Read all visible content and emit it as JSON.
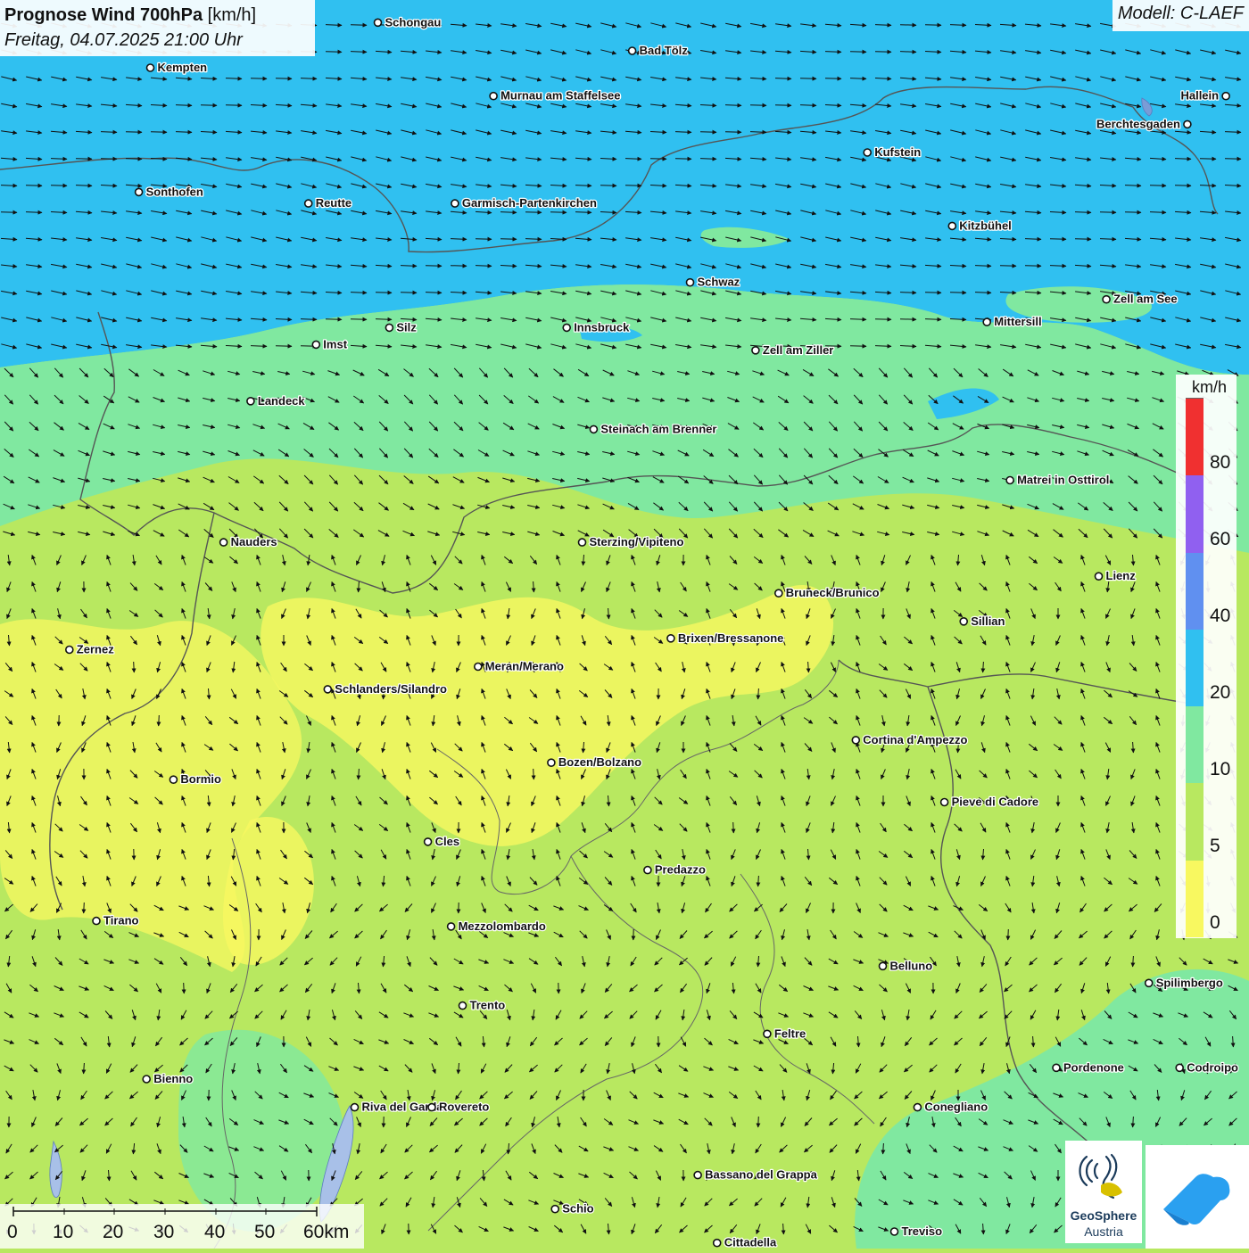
{
  "header": {
    "title_bold": "Prognose Wind 700hPa",
    "title_unit": "[km/h]",
    "datetime": "Freitag, 04.07.2025 21:00 Uhr"
  },
  "model": {
    "label": "Modell: C-LAEF"
  },
  "legend": {
    "unit": "km/h",
    "classes": [
      {
        "from": 0,
        "to": 5,
        "color": "#f8f860"
      },
      {
        "from": 5,
        "to": 10,
        "color": "#b8e860"
      },
      {
        "from": 10,
        "to": 20,
        "color": "#80e8a0"
      },
      {
        "from": 20,
        "to": 40,
        "color": "#30c0f0"
      },
      {
        "from": 40,
        "to": 60,
        "color": "#6090f0"
      },
      {
        "from": 60,
        "to": 80,
        "color": "#9060f0"
      },
      {
        "from": 80,
        "to": 100,
        "color": "#f03030"
      }
    ],
    "labels": [
      "0",
      "5",
      "10",
      "20",
      "40",
      "60",
      "80"
    ]
  },
  "scale": {
    "labels": [
      "0",
      "10",
      "20",
      "30",
      "40",
      "50",
      "60km"
    ]
  },
  "logo": {
    "name_line1": "GeoSphere",
    "name_line2": "Austria"
  },
  "cities": [
    {
      "name": "Schongau",
      "lon": 10.9,
      "lat": 47.81
    },
    {
      "name": "Bad Tölz",
      "lon": 11.56,
      "lat": 47.76
    },
    {
      "name": "Kempten",
      "lon": 10.31,
      "lat": 47.73
    },
    {
      "name": "Murnau am Staffelsee",
      "lon": 11.2,
      "lat": 47.68
    },
    {
      "name": "Hallein",
      "lon": 13.1,
      "lat": 47.68
    },
    {
      "name": "Berchtesgaden",
      "lon": 13.0,
      "lat": 47.63
    },
    {
      "name": "Kufstein",
      "lon": 12.17,
      "lat": 47.58
    },
    {
      "name": "Sonthofen",
      "lon": 10.28,
      "lat": 47.51
    },
    {
      "name": "Reutte",
      "lon": 10.72,
      "lat": 47.49
    },
    {
      "name": "Garmisch-Partenkirchen",
      "lon": 11.1,
      "lat": 47.49
    },
    {
      "name": "Kitzbühel",
      "lon": 12.39,
      "lat": 47.45
    },
    {
      "name": "Schwaz",
      "lon": 11.71,
      "lat": 47.35
    },
    {
      "name": "Zell am See",
      "lon": 12.79,
      "lat": 47.32
    },
    {
      "name": "Mittersill",
      "lon": 12.48,
      "lat": 47.28
    },
    {
      "name": "Innsbruck",
      "lon": 11.39,
      "lat": 47.27
    },
    {
      "name": "Silz",
      "lon": 10.93,
      "lat": 47.27
    },
    {
      "name": "Imst",
      "lon": 10.74,
      "lat": 47.24
    },
    {
      "name": "Zell am Ziller",
      "lon": 11.88,
      "lat": 47.23
    },
    {
      "name": "Landeck",
      "lon": 10.57,
      "lat": 47.14
    },
    {
      "name": "Steinach am Brenner",
      "lon": 11.46,
      "lat": 47.09
    },
    {
      "name": "Matrei in Osttirol",
      "lon": 12.54,
      "lat": 47.0
    },
    {
      "name": "Nauders",
      "lon": 10.5,
      "lat": 46.89
    },
    {
      "name": "Sterzing/Vipiteno",
      "lon": 11.43,
      "lat": 46.89
    },
    {
      "name": "Lienz",
      "lon": 12.77,
      "lat": 46.83
    },
    {
      "name": "Bruneck/Brunico",
      "lon": 11.94,
      "lat": 46.8
    },
    {
      "name": "Sillian",
      "lon": 12.42,
      "lat": 46.75
    },
    {
      "name": "Brixen/Bressanone",
      "lon": 11.66,
      "lat": 46.72
    },
    {
      "name": "Zernez",
      "lon": 10.1,
      "lat": 46.7
    },
    {
      "name": "Meran/Merano",
      "lon": 11.16,
      "lat": 46.67
    },
    {
      "name": "Schlanders/Silandro",
      "lon": 10.77,
      "lat": 46.63
    },
    {
      "name": "Cortina d'Ampezzo",
      "lon": 12.14,
      "lat": 46.54
    },
    {
      "name": "Bozen/Bolzano",
      "lon": 11.35,
      "lat": 46.5
    },
    {
      "name": "Bormio",
      "lon": 10.37,
      "lat": 46.47
    },
    {
      "name": "Pieve di Cadore",
      "lon": 12.37,
      "lat": 46.43
    },
    {
      "name": "Cles",
      "lon": 11.03,
      "lat": 46.36
    },
    {
      "name": "Predazzo",
      "lon": 11.6,
      "lat": 46.31
    },
    {
      "name": "Tirano",
      "lon": 10.17,
      "lat": 46.22
    },
    {
      "name": "Mezzolombardo",
      "lon": 11.09,
      "lat": 46.21
    },
    {
      "name": "Belluno",
      "lon": 12.21,
      "lat": 46.14
    },
    {
      "name": "Spilimbergo",
      "lon": 12.9,
      "lat": 46.11
    },
    {
      "name": "Trento",
      "lon": 11.12,
      "lat": 46.07
    },
    {
      "name": "Feltre",
      "lon": 11.91,
      "lat": 46.02
    },
    {
      "name": "Pordenone",
      "lon": 12.66,
      "lat": 45.96
    },
    {
      "name": "Codroipo",
      "lon": 12.98,
      "lat": 45.96
    },
    {
      "name": "Bienno",
      "lon": 10.3,
      "lat": 45.94
    },
    {
      "name": "Riva del Garda",
      "lon": 10.84,
      "lat": 45.89
    },
    {
      "name": "Rovereto",
      "lon": 11.04,
      "lat": 45.89
    },
    {
      "name": "Conegliano",
      "lon": 12.3,
      "lat": 45.89
    },
    {
      "name": "Bassano del Grappa",
      "lon": 11.73,
      "lat": 45.77
    },
    {
      "name": "Schio",
      "lon": 11.36,
      "lat": 45.71
    },
    {
      "name": "Treviso",
      "lon": 12.24,
      "lat": 45.67
    },
    {
      "name": "Cittadella",
      "lon": 11.78,
      "lat": 45.65
    }
  ]
}
